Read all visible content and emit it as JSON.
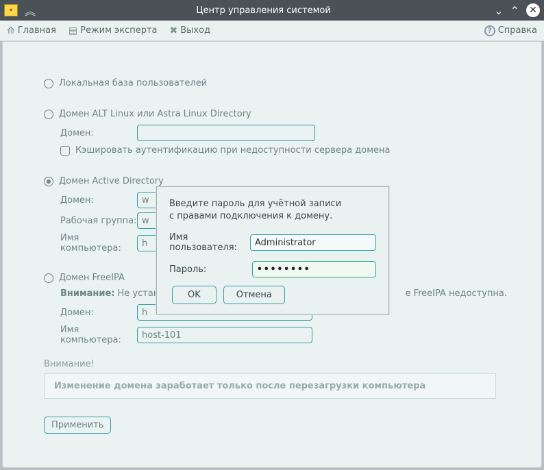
{
  "titlebar": {
    "title": "Центр управления системой"
  },
  "toolbar": {
    "home": "Главная",
    "expert": "Режим эксперта",
    "exit": "Выход",
    "help": "Справка"
  },
  "sections": {
    "local_label": "Локальная база пользователей",
    "alt": {
      "label": "Домен ALT Linux или Astra Linux Directory",
      "domain_label": "Домен:",
      "domain_value": "",
      "cache_label": "Кэшировать аутентификацию при недоступности сервера домена"
    },
    "ad": {
      "label": "Домен Active Directory",
      "domain_label": "Домен:",
      "domain_value": "w",
      "workgroup_label": "Рабочая группа:",
      "workgroup_value": "w",
      "hostname_label": "Имя компьютера:",
      "hostname_value": "h"
    },
    "ipa": {
      "label": "Домен FreeIPA",
      "warn_prefix": "Внимание:",
      "warn_text": "Не устан",
      "warn_tail": "е FreeIPA недоступна.",
      "domain_label": "Домен:",
      "domain_value": "h",
      "hostname_label": "Имя компьютера:",
      "hostname_value": "host-101"
    }
  },
  "notice": {
    "title": "Внимание!",
    "text": "Изменение домена заработает только после перезагрузки компьютера"
  },
  "apply_label": "Применить",
  "modal": {
    "text_l1": "Введите пароль для учётной записи",
    "text_l2": "с правами подключения к домену.",
    "user_label": "Имя пользователя:",
    "user_value": "Administrator",
    "pass_label": "Пароль:",
    "pass_value": "••••••••",
    "ok": "OK",
    "cancel": "Отмена"
  }
}
